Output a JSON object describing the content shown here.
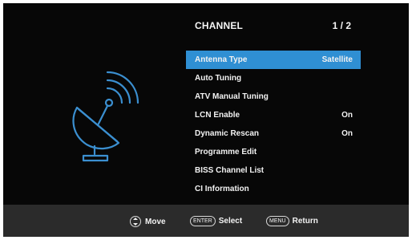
{
  "header": {
    "title": "CHANNEL",
    "page": "1 / 2"
  },
  "menu": {
    "items": [
      {
        "label": "Antenna Type",
        "value": "Satellite",
        "selected": true
      },
      {
        "label": "Auto Tuning",
        "value": ""
      },
      {
        "label": "ATV Manual Tuning",
        "value": ""
      },
      {
        "label": "LCN Enable",
        "value": "On"
      },
      {
        "label": "Dynamic Rescan",
        "value": "On"
      },
      {
        "label": "Programme Edit",
        "value": ""
      },
      {
        "label": "BISS Channel List",
        "value": ""
      },
      {
        "label": "CI Information",
        "value": ""
      }
    ]
  },
  "footer": {
    "move_label": "Move",
    "enter_key": "ENTER",
    "select_label": "Select",
    "menu_key": "MENU",
    "return_label": "Return"
  },
  "colors": {
    "accent": "#2f8fd3",
    "icon": "#3b8fd0",
    "panel": "#070707",
    "footer": "#2b2b2b"
  },
  "icons": {
    "satellite": "satellite-dish-icon",
    "move": "up-down-icon"
  }
}
